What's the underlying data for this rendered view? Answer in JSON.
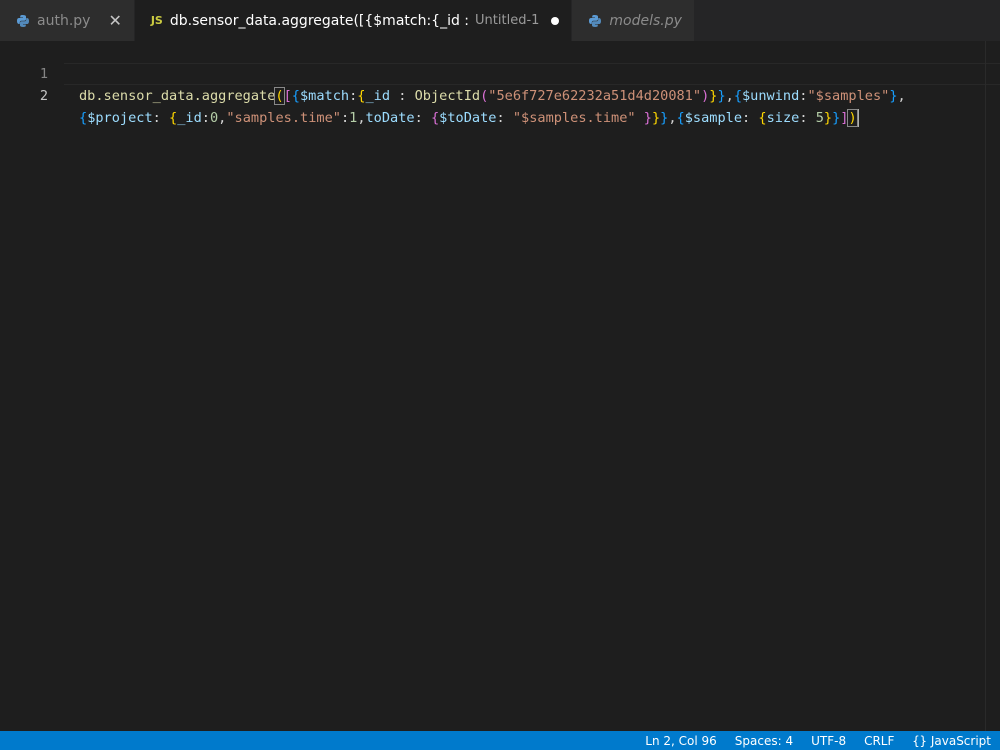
{
  "tabs": [
    {
      "icon": "python-icon",
      "label": "auth.py",
      "description": "",
      "active": false,
      "close": "✕"
    },
    {
      "icon": "javascript-icon",
      "icon_text": "JS",
      "label": "db.sensor_data.aggregate([{$match:{_id :",
      "description": "Untitled-1",
      "active": true,
      "modified": true
    },
    {
      "icon": "python-icon",
      "label": "models.py",
      "description": "",
      "active": false,
      "italic": true
    }
  ],
  "editor": {
    "line_numbers": [
      "1",
      "2"
    ],
    "line1": {
      "t1": "db.sensor_data.aggregate",
      "t2": "(",
      "t3": "[",
      "t4": "{",
      "t5": "$match",
      "t6": ":",
      "t7": "{",
      "t8": "_id",
      "t9": " : ",
      "t10": "ObjectId",
      "t11": "(",
      "t12": "\"5e6f727e62232a51d4d20081\"",
      "t13": ")",
      "t14": "}",
      "t15": "}",
      "t16": ",",
      "t17": "{",
      "t18": "$unwind",
      "t19": ":",
      "t20": "\"$samples\"",
      "t21": "}",
      "t22": ","
    },
    "line2": {
      "t1": "{",
      "t2": "$project",
      "t3": ": ",
      "t4": "{",
      "t5": "_id",
      "t6": ":",
      "t7": "0",
      "t8": ",",
      "t9": "\"samples.time\"",
      "t10": ":",
      "t11": "1",
      "t12": ",",
      "t13": "toDate",
      "t14": ": ",
      "t15": "{",
      "t16": "$toDate",
      "t17": ": ",
      "t18": "\"$samples.time\"",
      "t19": " ",
      "t20": "}",
      "t21": "}",
      "t22": "}",
      "t23": ",",
      "t24": "{",
      "t25": "$sample",
      "t26": ": ",
      "t27": "{",
      "t28": "size",
      "t29": ": ",
      "t30": "5",
      "t31": "}",
      "t32": "}",
      "t33": "]",
      "t34": ")"
    }
  },
  "statusbar": {
    "position": "Ln 2, Col 96",
    "indent": "Spaces: 4",
    "encoding": "UTF-8",
    "eol": "CRLF",
    "language_icon": "{}",
    "language": "JavaScript"
  },
  "colors": {
    "statusbar_bg": "#007acc",
    "editor_bg": "#1e1e1e",
    "tabbar_bg": "#252526"
  }
}
